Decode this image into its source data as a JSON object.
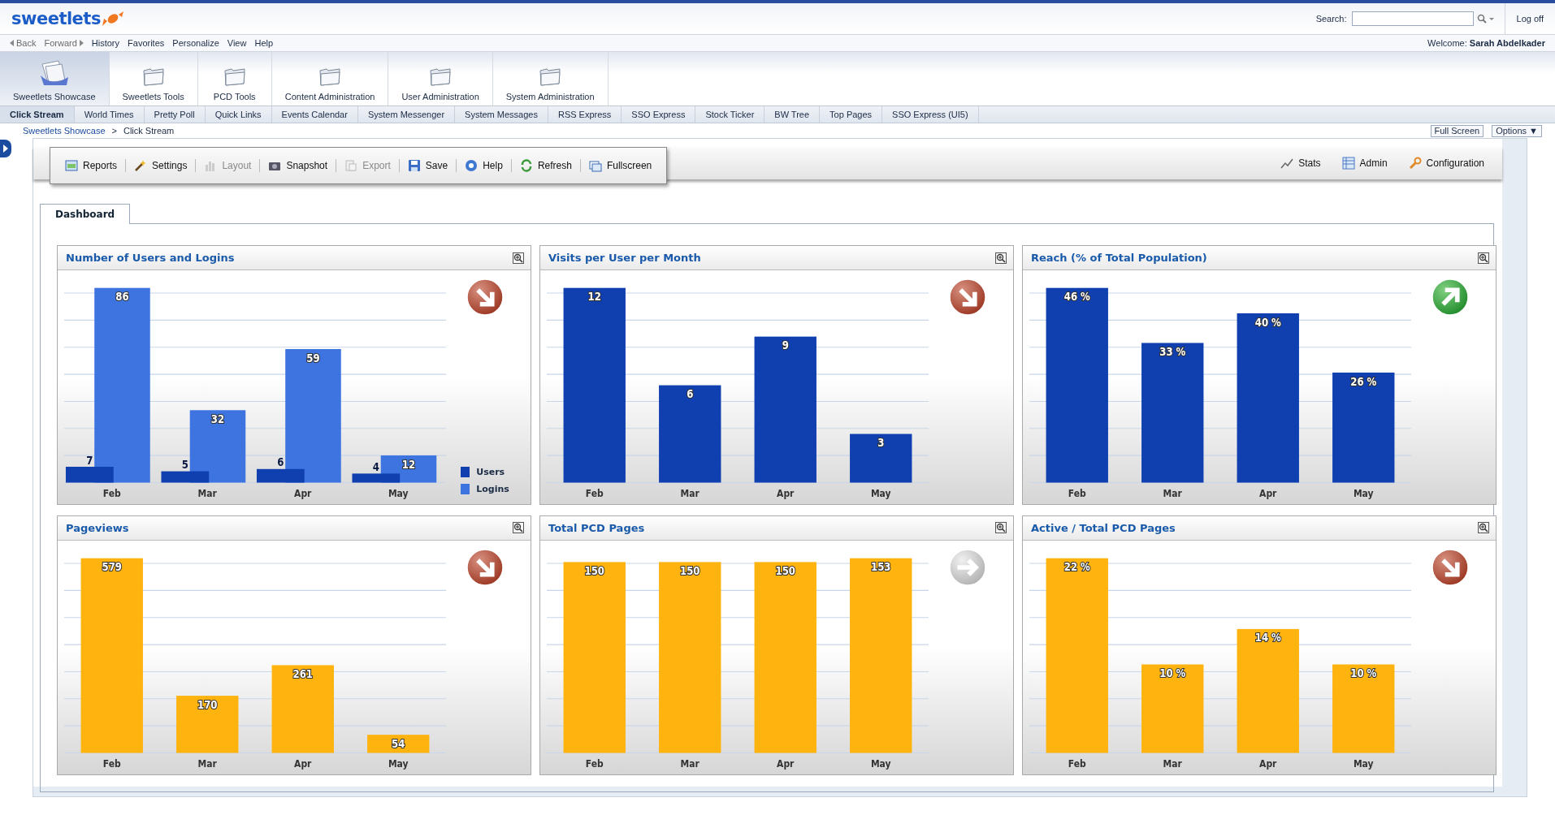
{
  "header": {
    "logo": "sweetlets",
    "search_label": "Search:",
    "logoff": "Log off"
  },
  "nav": {
    "items": [
      {
        "label": "Back",
        "kind": "back",
        "disabled": true
      },
      {
        "label": "Forward",
        "kind": "forward",
        "disabled": true
      },
      {
        "label": "History",
        "kind": "menu",
        "disabled": false
      },
      {
        "label": "Favorites",
        "kind": "menu",
        "disabled": false
      },
      {
        "label": "Personalize",
        "kind": "menu",
        "disabled": false
      },
      {
        "label": "View",
        "kind": "menu",
        "disabled": false
      },
      {
        "label": "Help",
        "kind": "menu",
        "disabled": false
      }
    ],
    "welcome": "Welcome: **Sarah Abdelkader**"
  },
  "top_tabs": [
    {
      "label": "Sweetlets Showcase",
      "kind": "docs",
      "selected": true
    },
    {
      "label": "Sweetlets Tools",
      "kind": "folder",
      "selected": false
    },
    {
      "label": "PCD Tools",
      "kind": "folder",
      "selected": false
    },
    {
      "label": "Content Administration",
      "kind": "folder",
      "selected": false
    },
    {
      "label": "User Administration",
      "kind": "folder",
      "selected": false
    },
    {
      "label": "System Administration",
      "kind": "folder",
      "selected": false
    }
  ],
  "sub_tabs": [
    {
      "label": "Click Stream",
      "selected": true
    },
    {
      "label": "World Times",
      "selected": false
    },
    {
      "label": "Pretty Poll",
      "selected": false
    },
    {
      "label": "Quick Links",
      "selected": false
    },
    {
      "label": "Events Calendar",
      "selected": false
    },
    {
      "label": "System Messenger",
      "selected": false
    },
    {
      "label": "System Messages",
      "selected": false
    },
    {
      "label": "RSS Express",
      "selected": false
    },
    {
      "label": "SSO Express",
      "selected": false
    },
    {
      "label": "Stock Ticker",
      "selected": false
    },
    {
      "label": "BW Tree",
      "selected": false
    },
    {
      "label": "Top Pages",
      "selected": false
    },
    {
      "label": "SSO Express (UI5)",
      "selected": false
    }
  ],
  "breadcrumb": {
    "items": [
      "Sweetlets Showcase",
      "Click Stream"
    ],
    "separator": ">",
    "buttons": [
      "Full Screen",
      "Options ▼"
    ]
  },
  "toolbar": {
    "items": [
      {
        "label": "Reports",
        "kind": "reports",
        "disabled": false
      },
      {
        "label": "Settings",
        "kind": "settings",
        "disabled": false
      },
      {
        "label": "Layout",
        "kind": "layout",
        "disabled": true
      },
      {
        "label": "Snapshot",
        "kind": "snapshot",
        "disabled": false
      },
      {
        "label": "Export",
        "kind": "export",
        "disabled": true
      },
      {
        "label": "Save",
        "kind": "save",
        "disabled": false
      },
      {
        "label": "Help",
        "kind": "help",
        "disabled": false
      },
      {
        "label": "Refresh",
        "kind": "refresh",
        "disabled": false
      },
      {
        "label": "Fullscreen",
        "kind": "fullscreen",
        "disabled": false
      }
    ],
    "right_items": [
      {
        "label": "Stats",
        "kind": "stats"
      },
      {
        "label": "Admin",
        "kind": "admin"
      },
      {
        "label": "Configuration",
        "kind": "configuration"
      }
    ]
  },
  "tabs": [
    {
      "label": "Dashboard",
      "selected": true
    }
  ],
  "panels": [
    {
      "title": "Number of Users and Logins",
      "trend_icon": {
        "kind": "down"
      },
      "chart_data": {
        "type": "bar",
        "categories": [
          "Feb",
          "Mar",
          "Apr",
          "May"
        ],
        "data_labels": true,
        "series": [
          {
            "name": "Logins",
            "color": "#3d74e0",
            "values": [
              86,
              32,
              59,
              12
            ]
          },
          {
            "name": "Users",
            "color": "#1040b0",
            "values": [
              7,
              5,
              6,
              4
            ]
          }
        ]
      }
    },
    {
      "title": "Visits per User per Month",
      "trend_icon": {
        "kind": "down"
      },
      "chart_data": {
        "type": "bar",
        "categories": [
          "Feb",
          "Mar",
          "Apr",
          "May"
        ],
        "data_labels": true,
        "series": [
          {
            "color": "#1040b0",
            "values": [
              12,
              6,
              9,
              3
            ]
          }
        ]
      }
    },
    {
      "title": "Reach (% of Total Population)",
      "trend_icon": {
        "kind": "up"
      },
      "label_unit": "%",
      "chart_data": {
        "type": "bar",
        "categories": [
          "Feb",
          "Mar",
          "Apr",
          "May"
        ],
        "data_labels": true,
        "series": [
          {
            "color": "#1040b0",
            "values": [
              46,
              33,
              40,
              26
            ]
          }
        ]
      }
    },
    {
      "title": "Pageviews",
      "trend_icon": {
        "kind": "down"
      },
      "chart_data": {
        "type": "bar",
        "categories": [
          "Feb",
          "Mar",
          "Apr",
          "May"
        ],
        "data_labels": true,
        "series": [
          {
            "color": "#ffb30f",
            "values": [
              579,
              170,
              261,
              54
            ]
          }
        ]
      }
    },
    {
      "title": "Total PCD Pages",
      "trend_icon": {
        "kind": "flat"
      },
      "chart_data": {
        "type": "bar",
        "categories": [
          "Feb",
          "Mar",
          "Apr",
          "May"
        ],
        "data_labels": true,
        "series": [
          {
            "color": "#ffb30f",
            "values": [
              150,
              150,
              150,
              153
            ]
          }
        ]
      }
    },
    {
      "title": "Active / Total PCD Pages",
      "trend_icon": {
        "kind": "down"
      },
      "label_unit": "%",
      "chart_data": {
        "type": "bar",
        "categories": [
          "Feb",
          "Mar",
          "Apr",
          "May"
        ],
        "data_labels": true,
        "series": [
          {
            "color": "#ffb30f",
            "values": [
              22,
              10,
              14,
              10
            ]
          }
        ]
      }
    }
  ]
}
